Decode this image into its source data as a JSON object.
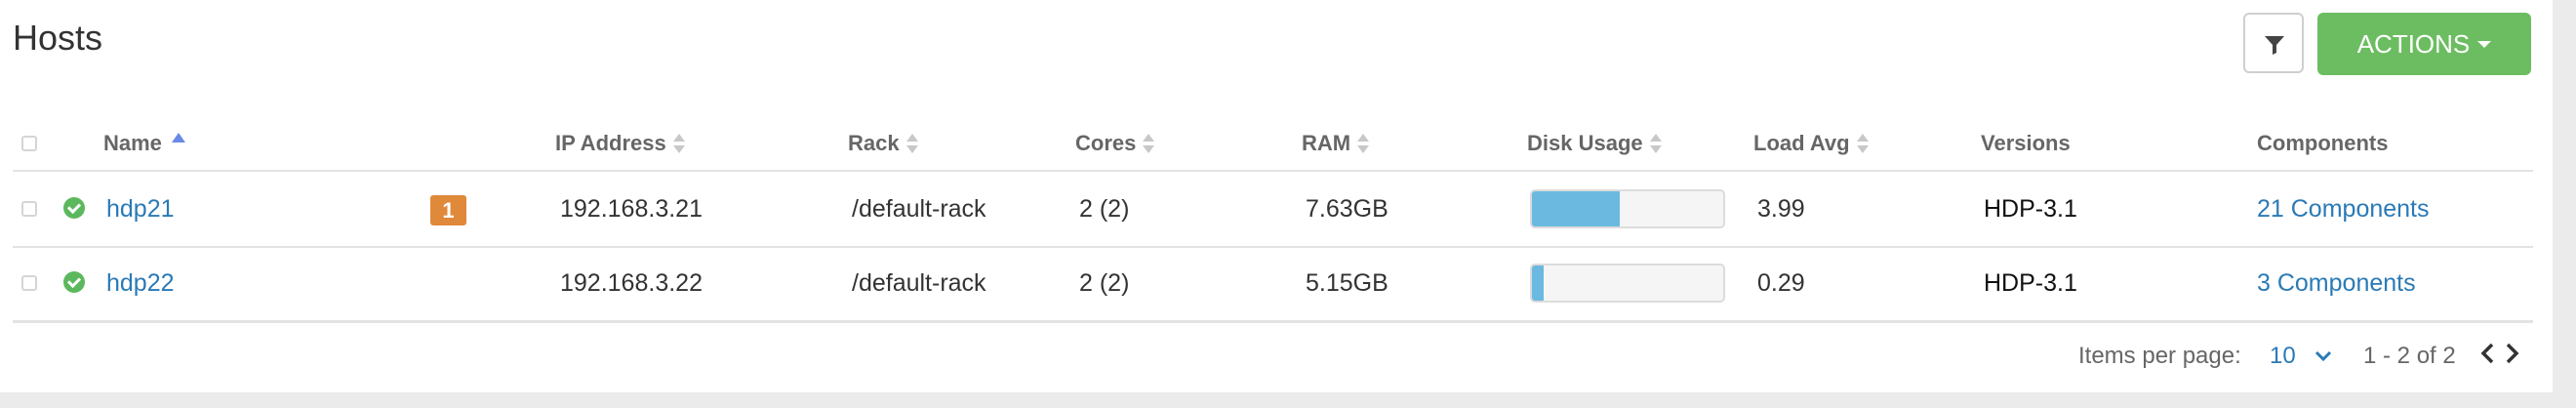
{
  "page": {
    "title": "Hosts"
  },
  "toolbar": {
    "filter_icon": "filter-icon",
    "actions_label": "ACTIONS",
    "actions_color": "#6cbd61"
  },
  "table": {
    "headers": {
      "name": "Name",
      "ip": "IP Address",
      "rack": "Rack",
      "cores": "Cores",
      "ram": "RAM",
      "disk": "Disk Usage",
      "load": "Load Avg",
      "versions": "Versions",
      "components": "Components"
    },
    "sorted_by": "Name",
    "rows": [
      {
        "status": "healthy",
        "name": "hdp21",
        "alerts": "1",
        "ip": "192.168.3.21",
        "rack": "/default-rack",
        "cores": "2 (2)",
        "ram": "7.63GB",
        "disk_fraction": 0.46,
        "load": "3.99",
        "version": "HDP-3.1",
        "components": "21 Components"
      },
      {
        "status": "healthy",
        "name": "hdp22",
        "alerts": "",
        "ip": "192.168.3.22",
        "rack": "/default-rack",
        "cores": "2 (2)",
        "ram": "5.15GB",
        "disk_fraction": 0.06,
        "load": "0.29",
        "version": "HDP-3.1",
        "components": "3 Components"
      }
    ]
  },
  "pagination": {
    "items_per_page_label": "Items per page:",
    "items_per_page": "10",
    "range": "1 - 2 of 2"
  },
  "colors": {
    "link": "#2a7ab6",
    "disk_fill": "#6bb9e0",
    "alert_badge": "#e0893b",
    "status_ok": "#5cb85c"
  }
}
